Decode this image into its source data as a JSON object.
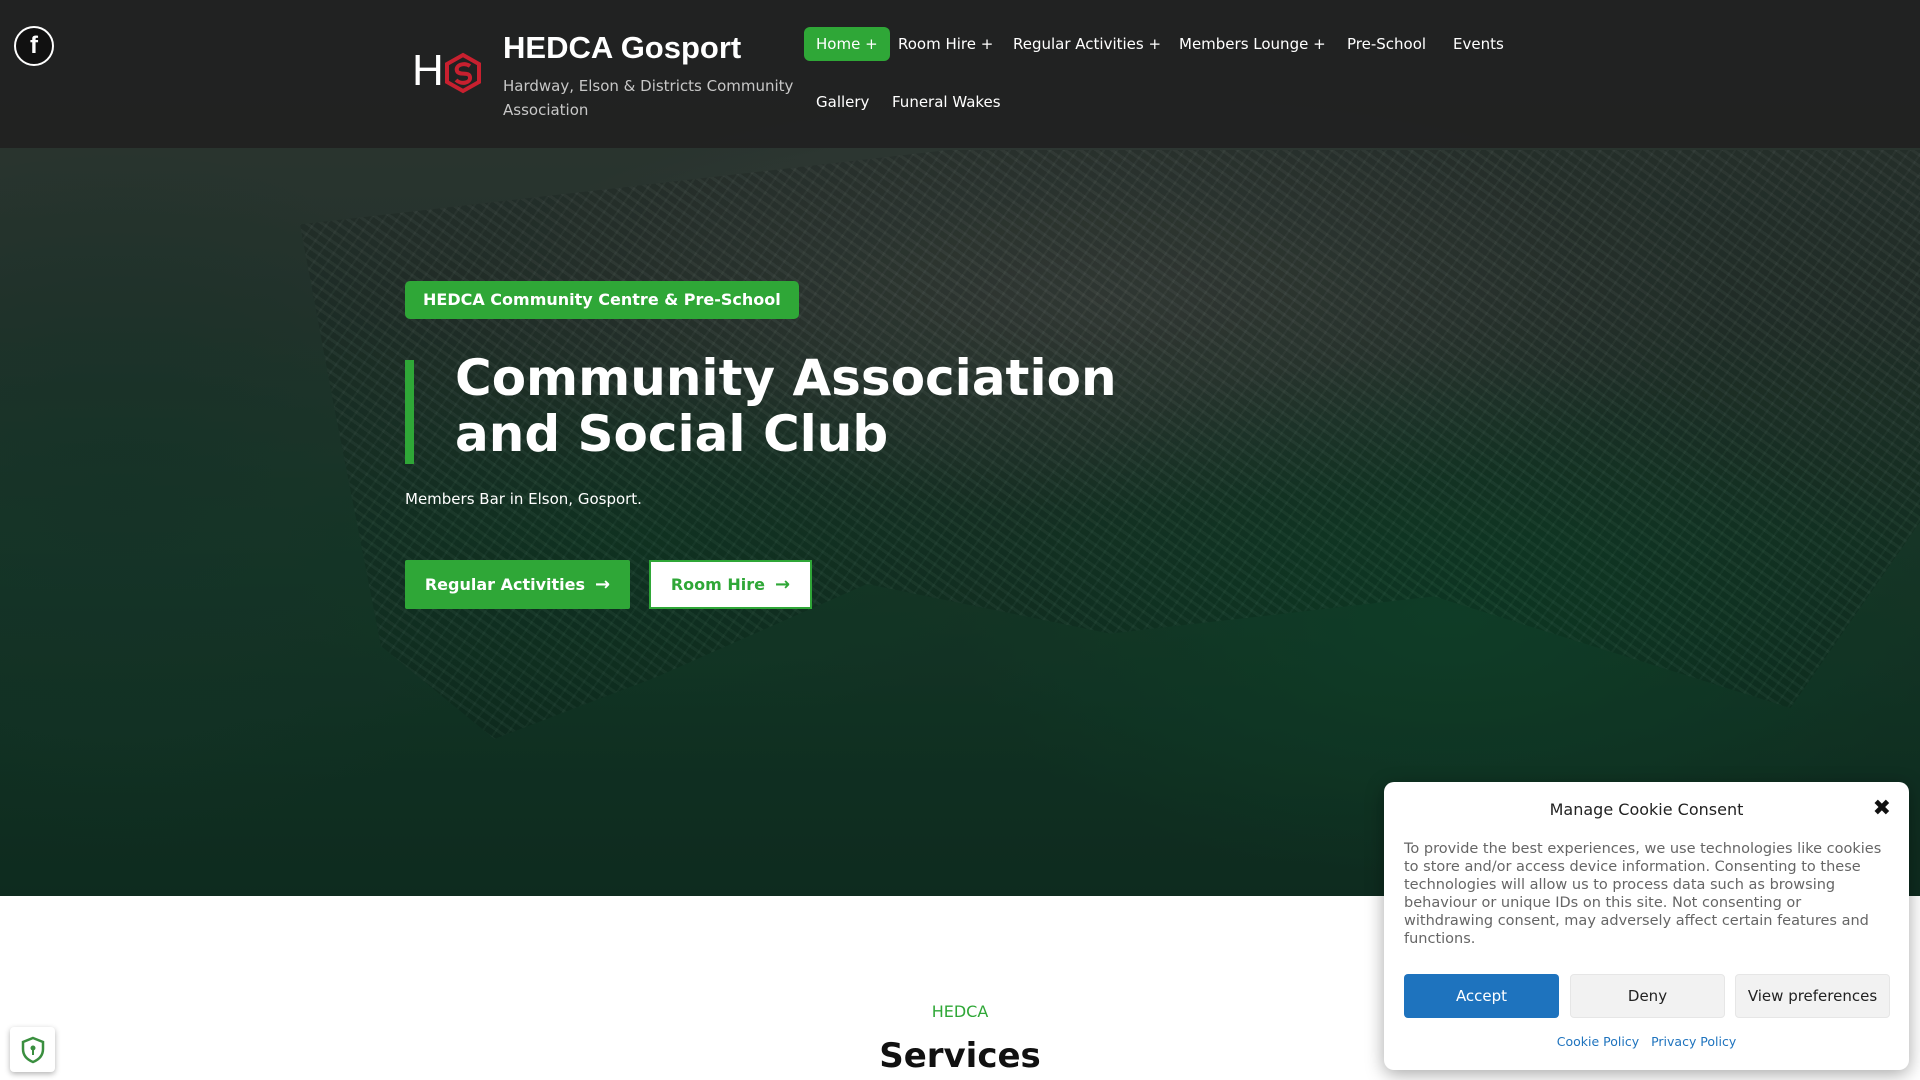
{
  "header": {
    "social_icon": "facebook-icon",
    "site_title": "HEDCA Gosport",
    "tagline": "Hardway, Elson & Districts Community Association",
    "logo_letter": "H",
    "brand_colors": {
      "accent": "#2fa737",
      "logo_red": "#c8202f",
      "header_bg": "#202020"
    }
  },
  "nav": {
    "items": [
      {
        "label": "Home +",
        "active": true
      },
      {
        "label": "Room Hire +"
      },
      {
        "label": "Regular Activities +"
      },
      {
        "label": "Members Lounge +"
      },
      {
        "label": "Pre-School"
      },
      {
        "label": "Events"
      },
      {
        "label": "Gallery"
      },
      {
        "label": "Funeral Wakes"
      }
    ]
  },
  "hero": {
    "tag": "HEDCA Community Centre & Pre-School",
    "heading_line1": "Community Association",
    "heading_line2": "and Social Club",
    "subtitle": "Members Bar in Elson, Gosport.",
    "primary_button": "Regular Activities",
    "secondary_button": "Room Hire",
    "arrow_glyph": "→"
  },
  "section": {
    "kicker": "HEDCA",
    "title": "Services"
  },
  "cookie_consent": {
    "title": "Manage Cookie Consent",
    "close_glyph": "✖",
    "body": "To provide the best experiences, we use technologies like cookies to store and/or access device information. Consenting to these technologies will allow us to process data such as browsing behaviour or unique IDs on this site. Not consenting or withdrawing consent, may adversely affect certain features and functions.",
    "accept": "Accept",
    "deny": "Deny",
    "preferences": "View preferences",
    "links": [
      "Cookie Policy",
      "Privacy Policy"
    ],
    "colors": {
      "accept_bg": "#1e73be"
    }
  }
}
